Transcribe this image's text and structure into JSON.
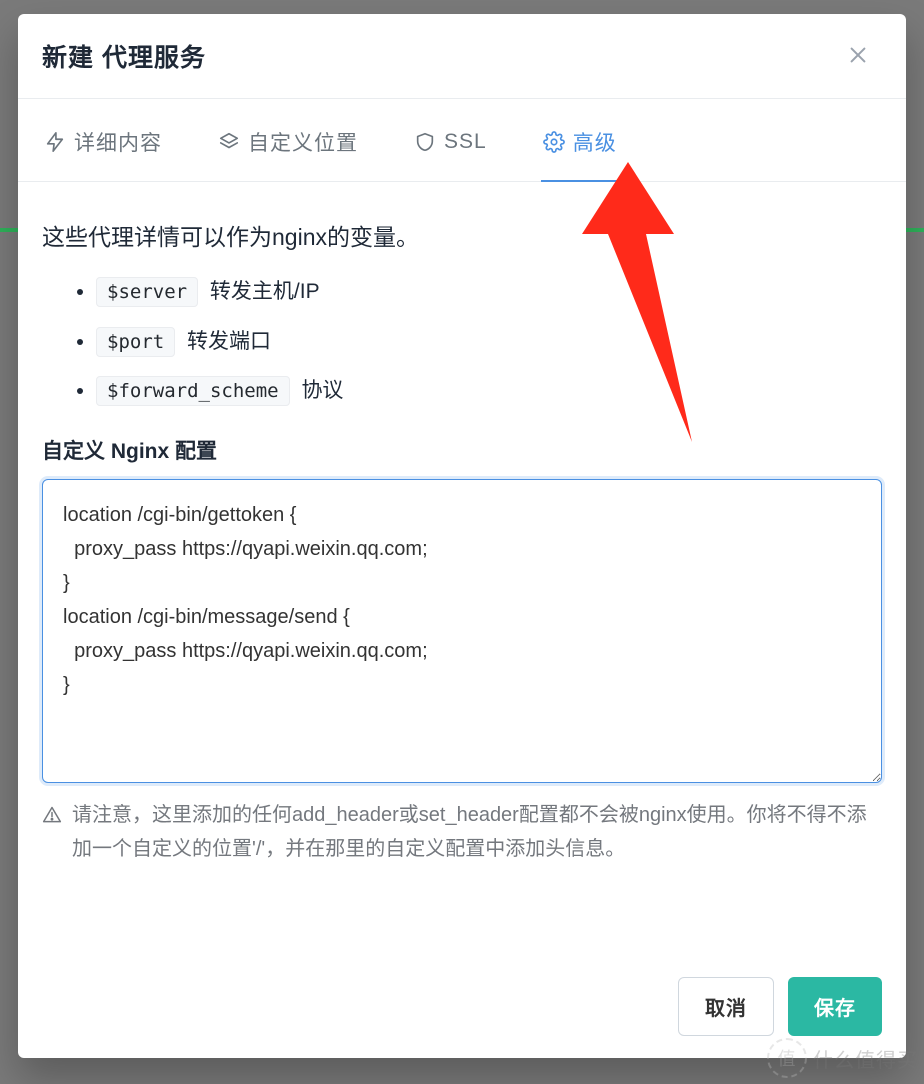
{
  "modal": {
    "title": "新建 代理服务"
  },
  "tabs": [
    {
      "label": "详细内容"
    },
    {
      "label": "自定义位置"
    },
    {
      "label": "SSL"
    },
    {
      "label": "高级"
    }
  ],
  "advanced": {
    "intro": "这些代理详情可以作为nginx的变量。",
    "vars": [
      {
        "variable": "$server",
        "desc": "转发主机/IP"
      },
      {
        "variable": "$port",
        "desc": "转发端口"
      },
      {
        "variable": "$forward_scheme",
        "desc": "协议"
      }
    ],
    "section_title": "自定义 Nginx 配置",
    "config_value": "location /cgi-bin/gettoken {\n  proxy_pass https://qyapi.weixin.qq.com;\n}\nlocation /cgi-bin/message/send {\n  proxy_pass https://qyapi.weixin.qq.com;\n}",
    "warning_text": "请注意，这里添加的任何add_header或set_header配置都不会被nginx使用。你将不得不添加一个自定义的位置'/'，并在那里的自定义配置中添加头信息。"
  },
  "footer": {
    "cancel": "取消",
    "save": "保存"
  },
  "watermark": {
    "badge": "值",
    "text": "什么值得买"
  }
}
